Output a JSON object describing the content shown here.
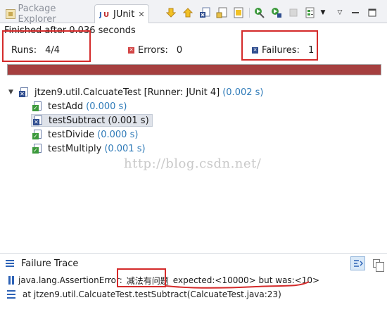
{
  "tabs": {
    "package_explorer": "Package Explorer",
    "junit": "JUnit",
    "junit_close": "✕"
  },
  "toolbar": {
    "icons": [
      "next-failure-icon",
      "previous-failure-icon",
      "show-failures-only-icon",
      "scroll-lock-icon",
      "show-skipped-icon",
      "rerun-icon",
      "rerun-failed-first-icon",
      "stop-icon",
      "history-icon",
      "history-dropdown-icon",
      "view-menu-icon",
      "minimize-icon",
      "maximize-icon"
    ]
  },
  "status": {
    "finished_text": "Finished after 0.036 seconds"
  },
  "counters": {
    "runs_label": "Runs:",
    "runs_value": "4/4",
    "errors_label": "Errors:",
    "errors_value": "0",
    "failures_label": "Failures:",
    "failures_value": "1"
  },
  "progress": {
    "fraction": 1.0,
    "color": "#a53f3f"
  },
  "tree": {
    "root_label": "jtzen9.util.CalcuateTest",
    "root_runner": "[Runner: JUnit 4]",
    "root_time": "(0.002 s)",
    "tests": [
      {
        "name": "testAdd",
        "time": "(0.000 s)",
        "status": "passed"
      },
      {
        "name": "testSubtract",
        "time": "(0.001 s)",
        "status": "failed"
      },
      {
        "name": "testDivide",
        "time": "(0.000 s)",
        "status": "passed"
      },
      {
        "name": "testMultiply",
        "time": "(0.001 s)",
        "status": "passed"
      }
    ]
  },
  "watermark": "http://blog.csdn.net/",
  "failure_trace": {
    "title": "Failure Trace",
    "exception": "java.lang.AssertionError:",
    "message": "减法有问题",
    "expected": "expected:<10000> but was:<10>",
    "stack_line": "at jtzen9.util.CalcuateTest.testSubtract(CalcuateTest.java:23)"
  },
  "colors": {
    "annotation_red": "#d42a2a",
    "failure_bar": "#a53f3f",
    "time_blue": "#2e7ab8"
  }
}
